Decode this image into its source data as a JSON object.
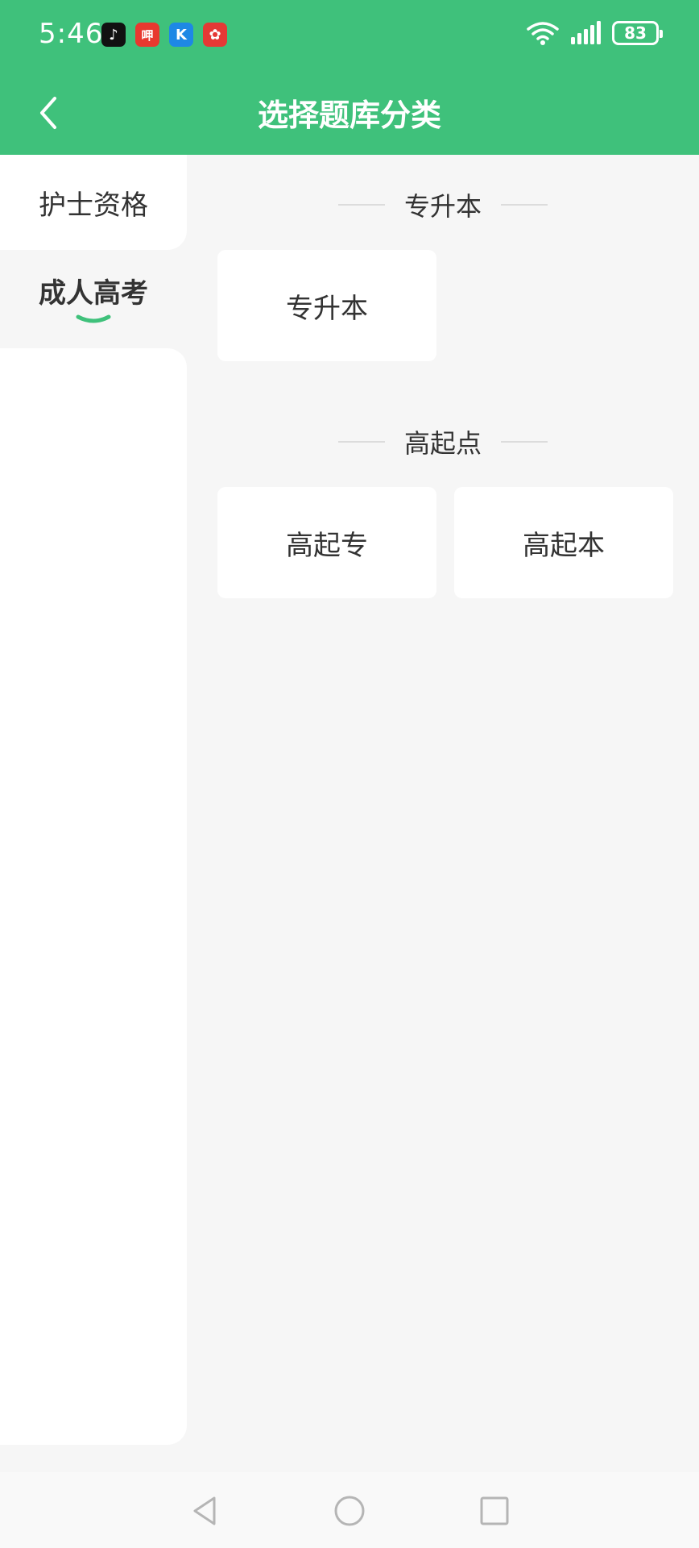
{
  "status_bar": {
    "time": "5:46",
    "battery": "83",
    "notification_icons": [
      {
        "name": "tiktok-icon",
        "glyph": "♪",
        "color": "#111111"
      },
      {
        "name": "app-red-icon",
        "glyph": "呷",
        "color": "#e8382f"
      },
      {
        "name": "app-blue-icon",
        "glyph": "K",
        "color": "#1e88e5"
      },
      {
        "name": "app-gift-icon",
        "glyph": "✿",
        "color": "#e53935"
      }
    ]
  },
  "header": {
    "title": "选择题库分类",
    "background_color": "#3fc17b"
  },
  "sidebar": {
    "items": [
      {
        "label": "护士资格",
        "active": false
      },
      {
        "label": "成人高考",
        "active": true
      }
    ],
    "indicator_color": "#3fc17b"
  },
  "sections": [
    {
      "title": "专升本",
      "cards": [
        "专升本"
      ]
    },
    {
      "title": "高起点",
      "cards": [
        "高起专",
        "高起本"
      ]
    }
  ]
}
